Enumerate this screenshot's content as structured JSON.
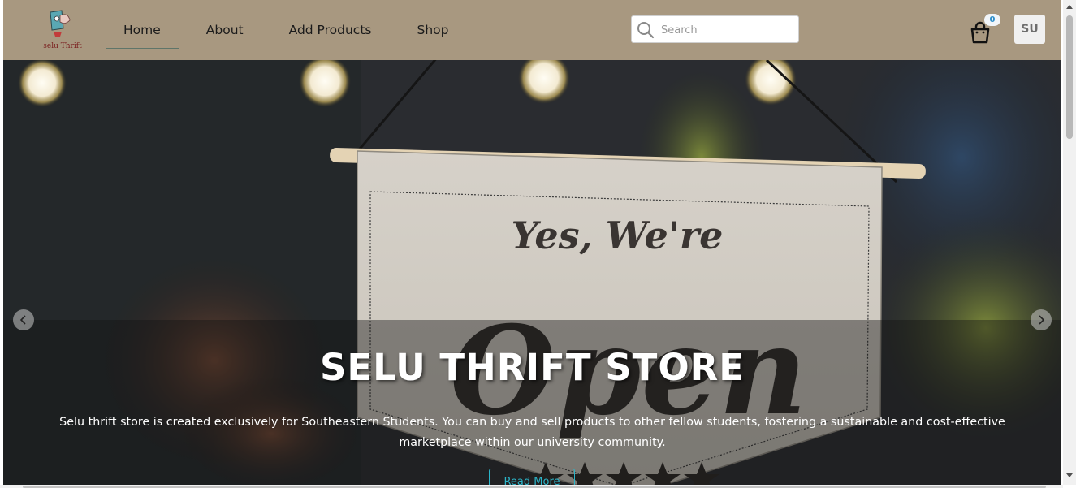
{
  "brand": {
    "logo_text": "selu Thrift"
  },
  "nav": {
    "items": [
      {
        "label": "Home",
        "active": true
      },
      {
        "label": "About"
      },
      {
        "label": "Add Products"
      },
      {
        "label": "Shop"
      }
    ]
  },
  "search": {
    "placeholder": "Search",
    "value": ""
  },
  "cart": {
    "count": "0"
  },
  "user": {
    "initials": "SU"
  },
  "hero": {
    "sign_line1": "Yes, We're",
    "sign_line2": "Open",
    "title": "SELU THRIFT STORE",
    "description": "Selu thrift store is created exclusively for Southeastern Students. You can buy and sell products to other fellow students, fostering a sustainable and cost-effective marketplace within our university community.",
    "button_label": "Read More"
  },
  "colors": {
    "navbar_bg": "#a89880",
    "accent": "#2bb5c9",
    "badge_text": "#2a8cc8"
  },
  "icons": [
    "search-icon",
    "shopping-bag-icon",
    "chevron-left-icon",
    "chevron-right-icon"
  ]
}
